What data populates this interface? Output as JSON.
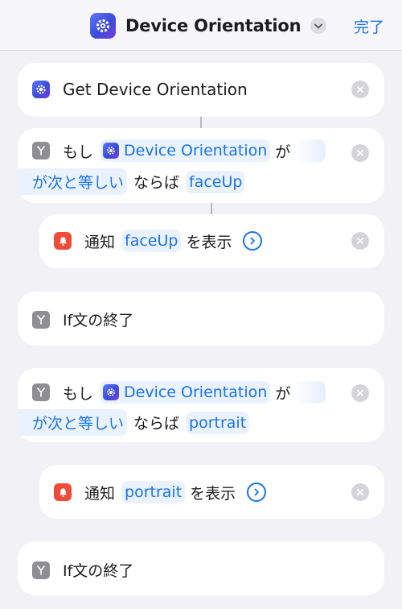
{
  "nav": {
    "title": "Device Orientation",
    "done_label": "完了",
    "app_icon": "shortcut-gear-icon"
  },
  "actions": [
    {
      "type": "get_device_orientation",
      "label": "Get Device Orientation"
    },
    {
      "type": "if",
      "prefix": "もし",
      "variable": "Device Orientation",
      "particle": "が",
      "condition": "が次と等しい",
      "then": "ならば",
      "value": "faceUp"
    },
    {
      "type": "show_notification",
      "label": "通知",
      "value": "faceUp",
      "suffix": "を表示"
    },
    {
      "type": "end_if",
      "label": "If文の終了"
    },
    {
      "type": "if",
      "prefix": "もし",
      "variable": "Device Orientation",
      "particle": "が",
      "condition": "が次と等しい",
      "then": "ならば",
      "value": "portrait"
    },
    {
      "type": "show_notification",
      "label": "通知",
      "value": "portrait",
      "suffix": "を表示"
    },
    {
      "type": "end_if",
      "label": "If文の終了"
    }
  ],
  "colors": {
    "accent": "#1a73e8",
    "token_bg": "#eaf2fe",
    "background": "#f2f2f6",
    "card": "#ffffff",
    "notification_icon": "#ef4b3b",
    "scripting_icon": "#8e8e93"
  }
}
